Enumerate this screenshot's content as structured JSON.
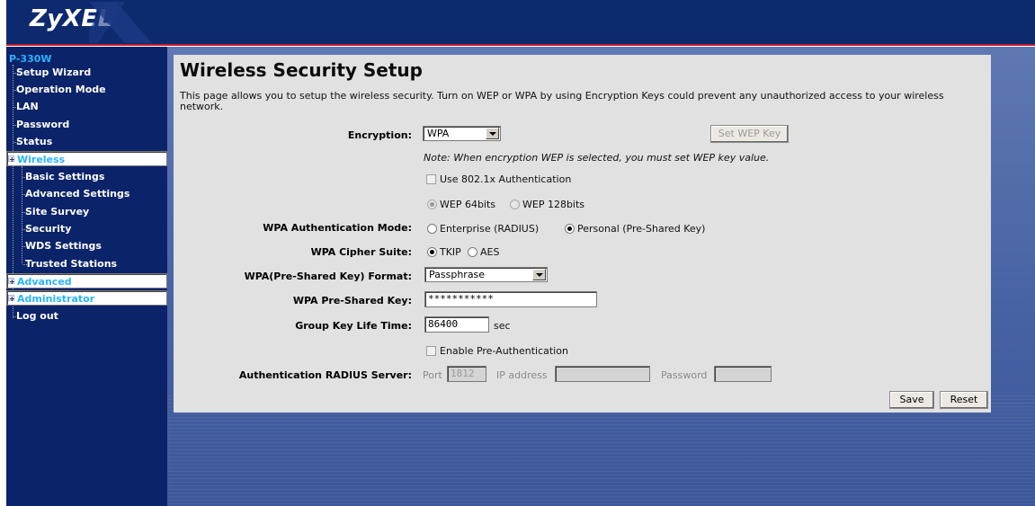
{
  "brand": {
    "logo_text": "ZyXEL"
  },
  "sidebar": {
    "root": "P-330W",
    "items": [
      {
        "label": "Setup Wizard"
      },
      {
        "label": "Operation Mode"
      },
      {
        "label": "LAN"
      },
      {
        "label": "Password"
      },
      {
        "label": "Status"
      },
      {
        "label": "Wireless"
      },
      {
        "label": "Basic Settings"
      },
      {
        "label": "Advanced Settings"
      },
      {
        "label": "Site Survey"
      },
      {
        "label": "Security"
      },
      {
        "label": "WDS Settings"
      },
      {
        "label": "Trusted Stations"
      },
      {
        "label": "Advanced"
      },
      {
        "label": "Administrator"
      },
      {
        "label": "Log out"
      }
    ],
    "expand_symbol": "+"
  },
  "page": {
    "title": "Wireless Security Setup",
    "description": "This page allows you to setup the wireless security. Turn on WEP or WPA by using Encryption Keys could prevent any unauthorized access to your wireless network."
  },
  "form": {
    "encryption": {
      "label": "Encryption:",
      "value": "WPA"
    },
    "set_wep_key_button": "Set WEP Key",
    "note": "Note: When encryption WEP is selected, you must set WEP key value.",
    "use_8021x": {
      "label": "Use 802.1x Authentication",
      "checked": false
    },
    "wep_64": "WEP 64bits",
    "wep_128": "WEP 128bits",
    "wpa_auth_mode": {
      "label": "WPA Authentication Mode:",
      "enterprise": "Enterprise (RADIUS)",
      "personal": "Personal (Pre-Shared Key)",
      "selected": "personal"
    },
    "cipher_suite": {
      "label": "WPA Cipher Suite:",
      "tkip": "TKIP",
      "aes": "AES",
      "selected": "tkip"
    },
    "psk_format": {
      "label": "WPA(Pre-Shared Key) Format:",
      "value": "Passphrase"
    },
    "psk": {
      "label": "WPA Pre-Shared Key:",
      "value": "***********"
    },
    "group_key": {
      "label": "Group Key Life Time:",
      "value": "86400",
      "unit": "sec"
    },
    "pre_auth": {
      "label": "Enable Pre-Authentication",
      "checked": false
    },
    "radius": {
      "label": "Authentication RADIUS Server:",
      "port_label": "Port",
      "port_value": "1812",
      "ip_label": "IP address",
      "ip_value": "",
      "password_label": "Password",
      "password_value": ""
    },
    "save_button": "Save",
    "reset_button": "Reset"
  }
}
